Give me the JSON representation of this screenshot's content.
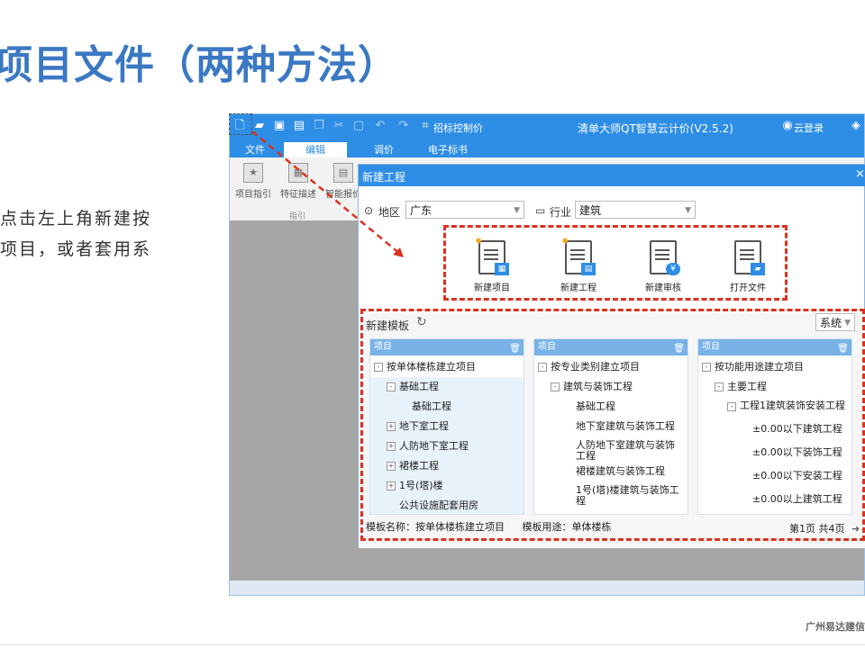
{
  "slide": {
    "title": "项目文件（两种方法）",
    "desc_line1": "点击左上角新建按",
    "desc_line2": "项目，或者套用系",
    "footer": "广州易达建信"
  },
  "app": {
    "title": "清单大师QT智慧云计价(V2.5.2)",
    "quick_access": [
      "new-file-icon",
      "open-folder-icon",
      "save-icon",
      "save-as-icon",
      "copy-icon",
      "cut-icon",
      "paste-icon",
      "undo-icon",
      "redo-icon"
    ],
    "tender_control_label": "招标控制价",
    "cloud_login": "云登录",
    "menu": [
      "文件",
      "编辑",
      "调价",
      "电子标书"
    ],
    "ribbon": {
      "buttons": [
        "项目指引",
        "特征描述",
        "智能报价"
      ],
      "group": "指引"
    }
  },
  "dialog": {
    "title": "新建工程",
    "region_label": "地区",
    "region_value": "广东",
    "industry_label": "行业",
    "industry_value": "建筑",
    "actions": [
      "新建项目",
      "新建工程",
      "新建审核",
      "打开文件"
    ],
    "template_label": "新建模板",
    "system_value": "系统",
    "columns": [
      {
        "header": "项目",
        "nodes": [
          {
            "t": "按单体楼栋建立项目",
            "lvl": 0,
            "exp": "-"
          },
          {
            "t": "基础工程",
            "lvl": 1,
            "exp": "-"
          },
          {
            "t": "基础工程",
            "lvl": 2,
            "exp": ""
          },
          {
            "t": "地下室工程",
            "lvl": 1,
            "exp": "+"
          },
          {
            "t": "人防地下室工程",
            "lvl": 1,
            "exp": "+"
          },
          {
            "t": "裙楼工程",
            "lvl": 1,
            "exp": "+"
          },
          {
            "t": "1号(塔)楼",
            "lvl": 1,
            "exp": "+"
          },
          {
            "t": "公共设施配套用房",
            "lvl": 1,
            "exp": ""
          }
        ]
      },
      {
        "header": "项目",
        "nodes": [
          {
            "t": "按专业类别建立项目",
            "lvl": 0,
            "exp": "-"
          },
          {
            "t": "建筑与装饰工程",
            "lvl": 1,
            "exp": "-"
          },
          {
            "t": "基础工程",
            "lvl": 2,
            "exp": ""
          },
          {
            "t": "地下室建筑与装饰工程",
            "lvl": 2,
            "exp": ""
          },
          {
            "t": "人防地下室建筑与装饰工程",
            "lvl": 2,
            "exp": ""
          },
          {
            "t": "裙楼建筑与装饰工程",
            "lvl": 2,
            "exp": ""
          },
          {
            "t": "1号(塔)楼建筑与装饰工程",
            "lvl": 2,
            "exp": ""
          }
        ]
      },
      {
        "header": "项目",
        "nodes": [
          {
            "t": "按功能用途建立项目",
            "lvl": 0,
            "exp": "-"
          },
          {
            "t": "主要工程",
            "lvl": 1,
            "exp": "-"
          },
          {
            "t": "工程1建筑装饰安装工程",
            "lvl": 2,
            "exp": "-"
          },
          {
            "t": "±0.00以下建筑工程",
            "lvl": 3,
            "exp": ""
          },
          {
            "t": "±0.00以下装饰工程",
            "lvl": 3,
            "exp": ""
          },
          {
            "t": "±0.00以下安装工程",
            "lvl": 3,
            "exp": ""
          },
          {
            "t": "±0.00以上建筑工程",
            "lvl": 3,
            "exp": ""
          }
        ]
      }
    ],
    "template_name_label": "模板名称：按单体楼栋建立项目",
    "template_use_label": "模板用途：单体楼栋",
    "pager": "第1页 共4页"
  },
  "colors": {
    "title_blue": "#3b78c3",
    "app_blue": "#2e8ee6",
    "annotation_red": "#d9331f"
  }
}
